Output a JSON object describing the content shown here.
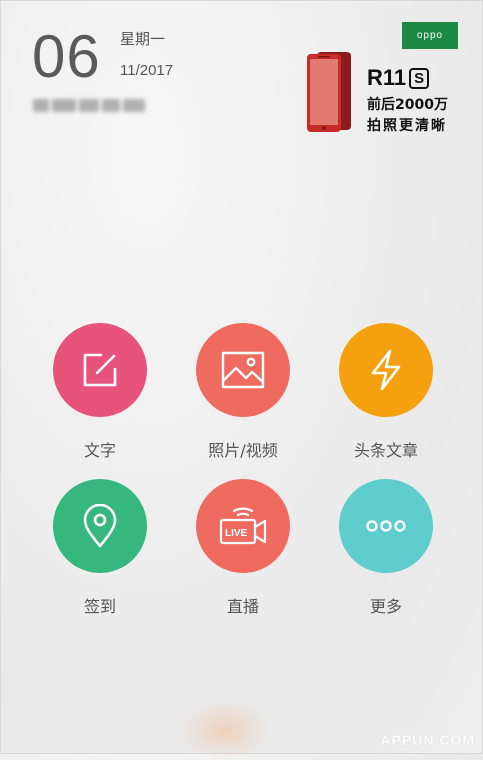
{
  "date": {
    "day": "06",
    "weekday": "星期一",
    "month_year": "11/2017"
  },
  "ad": {
    "brand": "oppo",
    "model": "R11",
    "model_suffix": "S",
    "line1": "前后2000万",
    "line2": "拍照更清晰",
    "colors": {
      "brand_bg": "#1c8a45",
      "phone": "#c92a2a"
    }
  },
  "actions": [
    {
      "label": "文字",
      "icon": "edit-icon",
      "color": "#e8537c"
    },
    {
      "label": "照片/视频",
      "icon": "image-icon",
      "color": "#ef6b60"
    },
    {
      "label": "头条文章",
      "icon": "lightning-icon",
      "color": "#f5a00e"
    },
    {
      "label": "签到",
      "icon": "location-pin-icon",
      "color": "#36b77e"
    },
    {
      "label": "直播",
      "icon": "live-camera-icon",
      "color": "#ef6b60"
    },
    {
      "label": "更多",
      "icon": "more-dots-icon",
      "color": "#5fcccd"
    }
  ],
  "live_badge": "LIVE",
  "watermark": "APPUN.COM"
}
